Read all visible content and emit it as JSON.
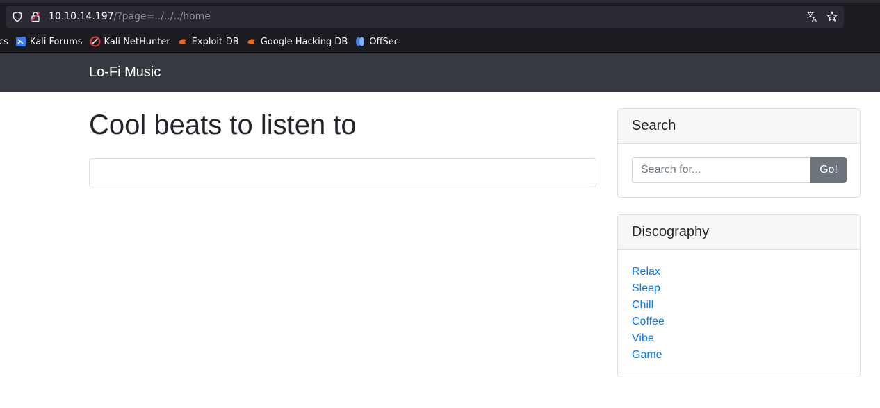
{
  "browser": {
    "url_host": "10.10.14.197",
    "url_path": "/?page=../../../home",
    "bookmarks": [
      {
        "label": "cs",
        "icon": "partial-bookmark-icon"
      },
      {
        "label": "Kali Forums",
        "icon": "kali-forums-icon"
      },
      {
        "label": "Kali NetHunter",
        "icon": "kali-nethunter-icon"
      },
      {
        "label": "Exploit-DB",
        "icon": "exploit-db-icon"
      },
      {
        "label": "Google Hacking DB",
        "icon": "ghdb-icon"
      },
      {
        "label": "OffSec",
        "icon": "offsec-icon"
      }
    ]
  },
  "site": {
    "brand": "Lo-Fi Music",
    "heading": "Cool beats to listen to"
  },
  "search": {
    "title": "Search",
    "placeholder": "Search for...",
    "button_label": "Go!"
  },
  "discography": {
    "title": "Discography",
    "items": [
      "Relax",
      "Sleep",
      "Chill",
      "Coffee",
      "Vibe",
      "Game"
    ]
  },
  "colors": {
    "navbar_bg": "#343a40",
    "link": "#007bff",
    "button_bg": "#6c757d",
    "chrome_bg": "#1c1b22"
  }
}
